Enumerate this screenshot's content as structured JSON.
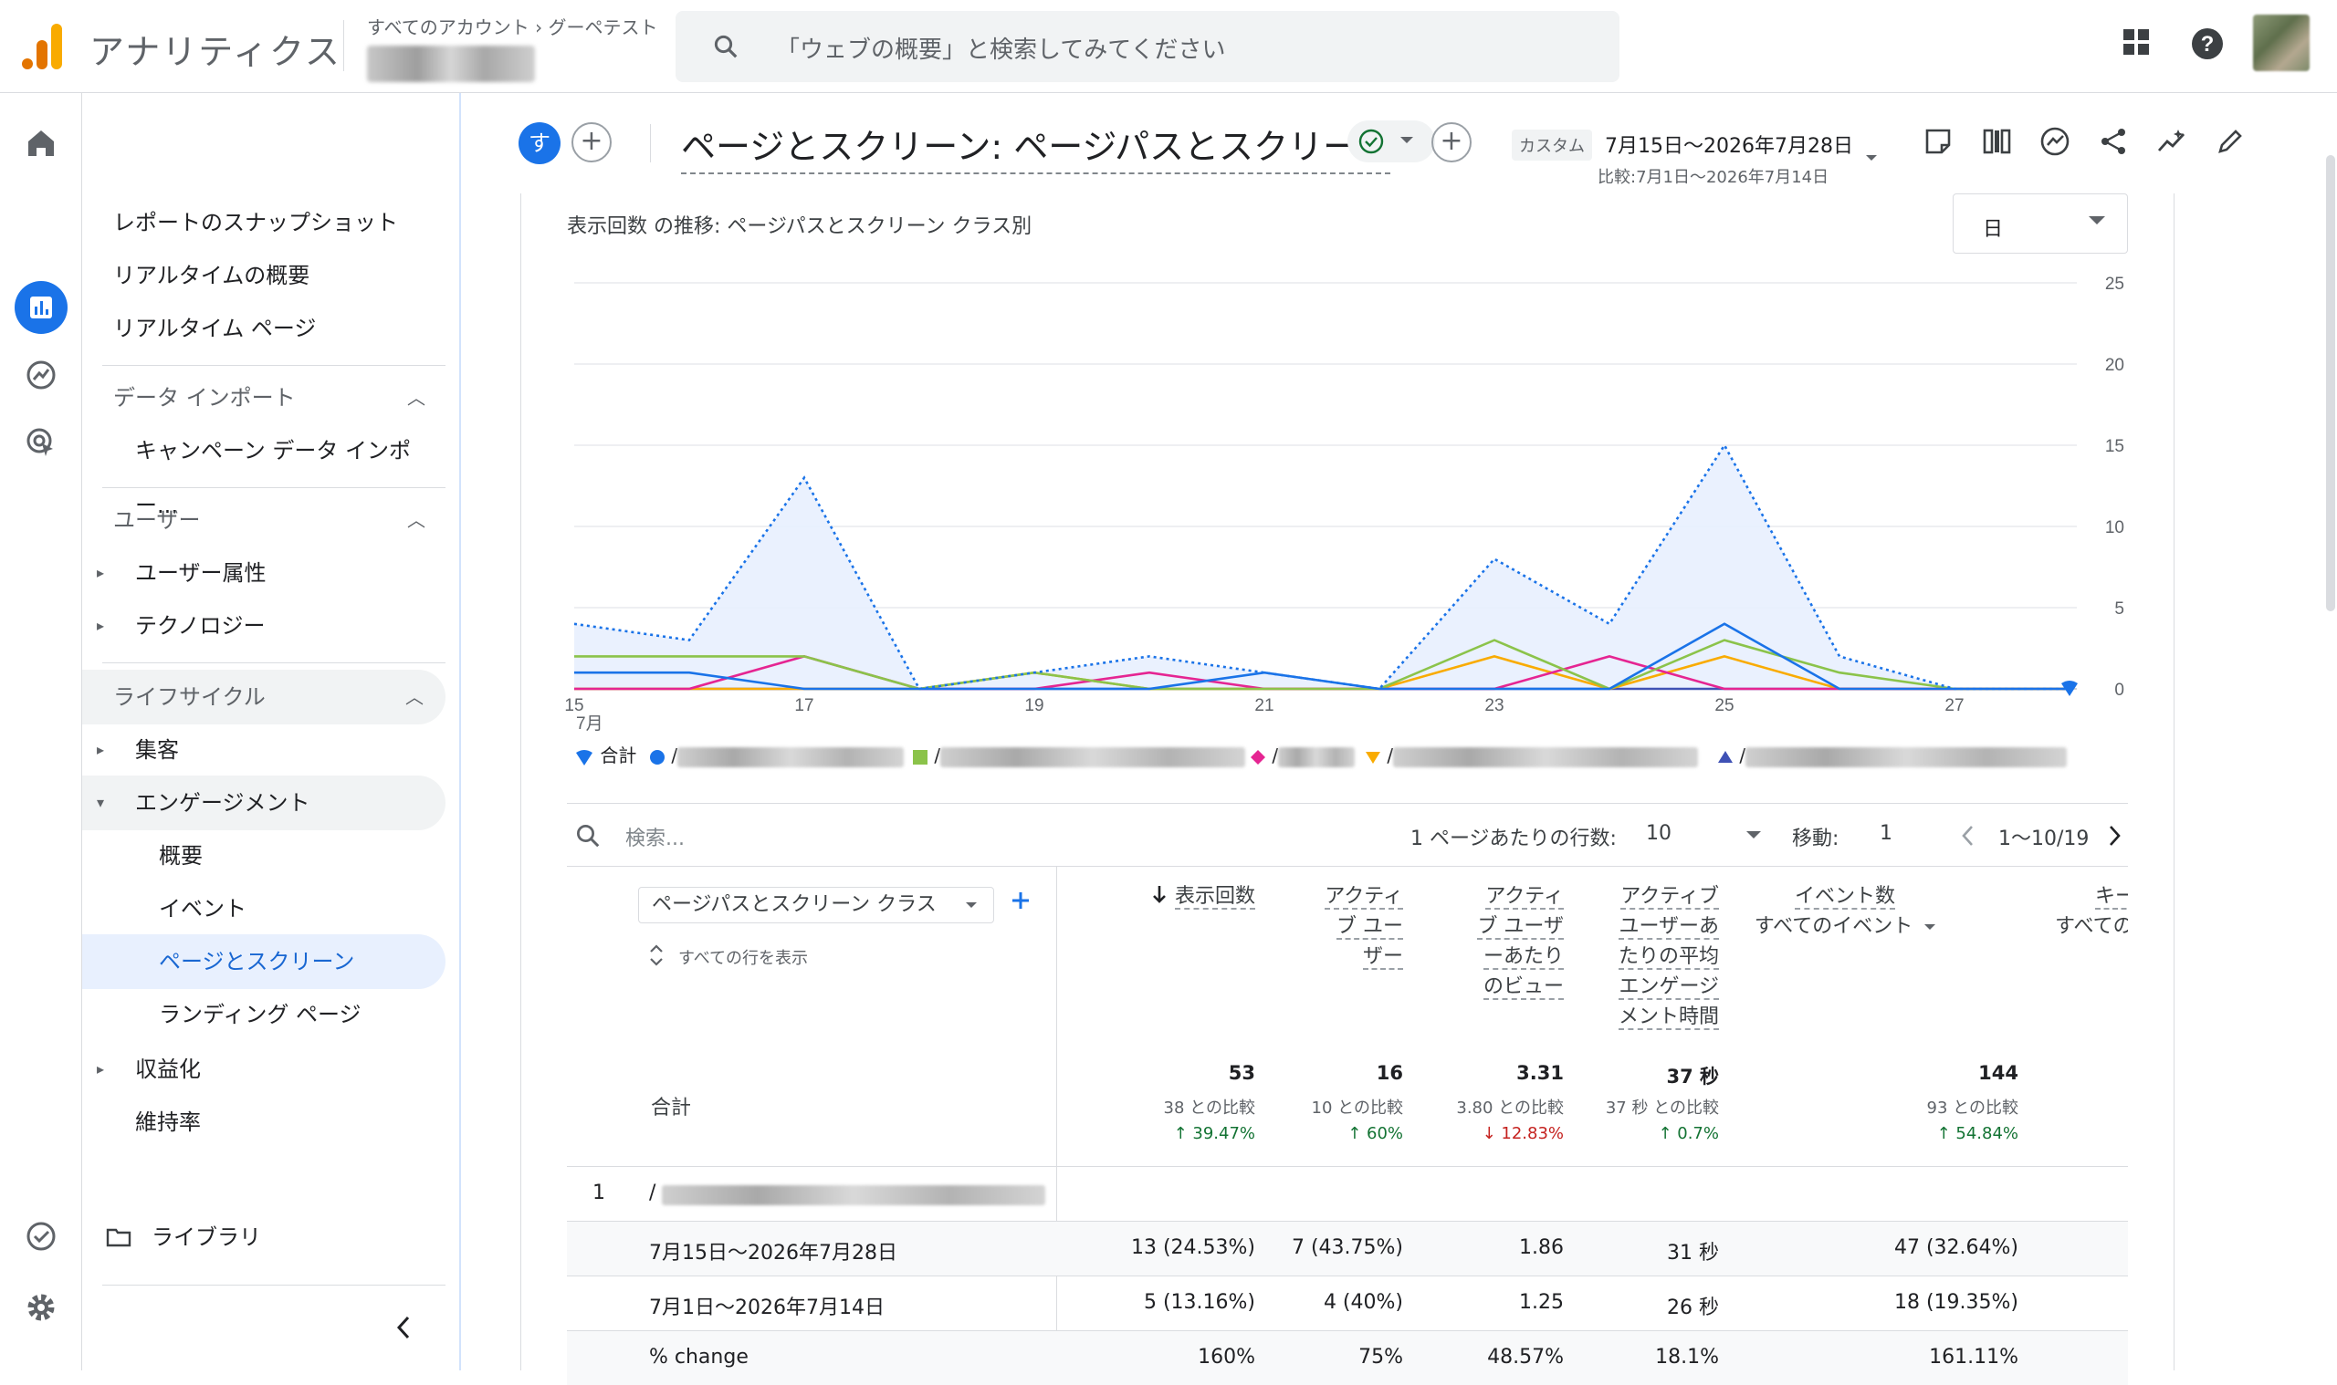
{
  "app": {
    "name": "アナリティクス",
    "breadcrumb_accounts": "すべてのアカウント",
    "breadcrumb_property": "グーペテスト",
    "search_placeholder": "「ウェブの概要」と検索してみてください"
  },
  "nav": {
    "items": [
      {
        "label": "レポートのスナップショット"
      },
      {
        "label": "リアルタイムの概要"
      },
      {
        "label": "リアルタイム ページ"
      }
    ],
    "data_import": {
      "label": "データ インポート",
      "child": "キャンペーン データ インポー..."
    },
    "user": {
      "label": "ユーザー",
      "children": [
        "ユーザー属性",
        "テクノロジー"
      ]
    },
    "lifecycle": {
      "label": "ライフサイクル",
      "acquisition": "集客",
      "engagement": "エンゲージメント",
      "engagement_children": [
        "概要",
        "イベント",
        "ページとスクリーン",
        "ランディング ページ"
      ],
      "monetization": "収益化",
      "retention": "維持率"
    },
    "library": "ライブラリ"
  },
  "header": {
    "avatar_initial": "す",
    "title": "ページとスクリーン: ページパスとスクリー...",
    "date_label": "カスタム",
    "date_range": "7月15日～2026年7月28日",
    "date_compare": "比較:7月1日～2026年7月14日"
  },
  "chart": {
    "title": "表示回数 の推移: ページパスとスクリーン クラス別",
    "granularity": "日",
    "month_label": "7月"
  },
  "chart_data": {
    "type": "line",
    "x": [
      15,
      16,
      17,
      18,
      19,
      20,
      21,
      22,
      23,
      24,
      25,
      26,
      27,
      28
    ],
    "xticks": [
      "15",
      "17",
      "19",
      "21",
      "23",
      "25",
      "27"
    ],
    "ylim": [
      0,
      25
    ],
    "yticks": [
      0,
      5,
      10,
      15,
      20,
      25
    ],
    "series": [
      {
        "name": "合計",
        "color": "#1a73e8",
        "style": "dotted-area",
        "values": [
          4,
          3,
          13,
          0,
          1,
          2,
          1,
          0,
          8,
          4,
          15,
          2,
          0,
          0
        ]
      },
      {
        "name": "/",
        "color": "#1a73e8",
        "values": [
          1,
          1,
          0,
          0,
          0,
          0,
          1,
          0,
          0,
          0,
          4,
          0,
          0,
          0
        ]
      },
      {
        "name": "/",
        "color": "#8bc34a",
        "values": [
          2,
          2,
          2,
          0,
          1,
          0,
          0,
          0,
          3,
          0,
          3,
          1,
          0,
          0
        ]
      },
      {
        "name": "/",
        "color": "#e52592",
        "values": [
          0,
          0,
          2,
          0,
          0,
          1,
          0,
          0,
          0,
          2,
          0,
          0,
          0,
          0
        ]
      },
      {
        "name": "/",
        "color": "#f9ab00",
        "values": [
          0,
          0,
          0,
          0,
          1,
          0,
          0,
          0,
          2,
          0,
          2,
          0,
          0,
          0
        ]
      },
      {
        "name": "/",
        "color": "#3f51b5",
        "values": [
          0,
          0,
          0,
          0,
          0,
          0,
          0,
          0,
          0,
          0,
          0,
          0,
          0,
          0
        ]
      }
    ]
  },
  "table": {
    "search_placeholder": "検索...",
    "rows_per_page_label": "1 ページあたりの行数:",
    "rows_per_page": "10",
    "goto_label": "移動:",
    "goto_value": "1",
    "pagination": "1～10/19",
    "dimension": "ページパスとスクリーン クラス",
    "show_all_rows": "すべての行を表示",
    "columns": [
      {
        "lines": [
          "表示回数"
        ]
      },
      {
        "lines": [
          "アクティ",
          "ブ ユー",
          "ザー"
        ]
      },
      {
        "lines": [
          "アクティ",
          "ブ ユーザ",
          "ーあたり",
          "のビュー"
        ]
      },
      {
        "lines": [
          "アクティブ",
          "ユーザーあ",
          "たりの平均",
          "エンゲージ",
          "メント時間"
        ]
      },
      {
        "lines": [
          "イベント数"
        ],
        "sub": "すべてのイベント"
      },
      {
        "lines": [
          "キー"
        ],
        "sub": "すべての"
      }
    ],
    "totals_label": "合計",
    "totals": [
      {
        "value": "53",
        "compare": "38 との比較",
        "change": "39.47%",
        "dir": "up"
      },
      {
        "value": "16",
        "compare": "10 との比較",
        "change": "60%",
        "dir": "up"
      },
      {
        "value": "3.31",
        "compare": "3.80 との比較",
        "change": "12.83%",
        "dir": "down"
      },
      {
        "value": "37 秒",
        "compare": "37 秒 との比較",
        "change": "0.7%",
        "dir": "up"
      },
      {
        "value": "144",
        "compare": "93 との比較",
        "change": "54.84%",
        "dir": "up"
      }
    ],
    "row1_index": "1",
    "row1_path": "/",
    "sub_rows": [
      {
        "label": "7月15日～2026年7月28日",
        "values": [
          "13 (24.53%)",
          "7 (43.75%)",
          "1.86",
          "31 秒",
          "47 (32.64%)"
        ]
      },
      {
        "label": "7月1日～2026年7月14日",
        "values": [
          "5 (13.16%)",
          "4 (40%)",
          "1.25",
          "26 秒",
          "18 (19.35%)"
        ]
      },
      {
        "label": "% change",
        "values": [
          "160%",
          "75%",
          "48.57%",
          "18.1%",
          "161.11%"
        ]
      }
    ]
  }
}
